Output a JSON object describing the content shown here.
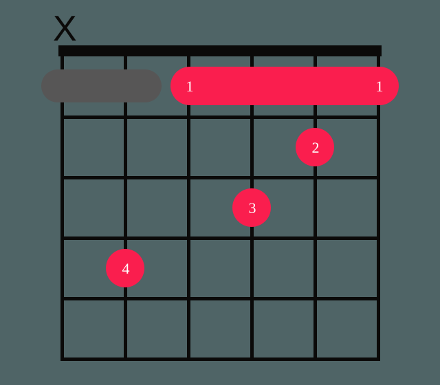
{
  "chart_data": {
    "type": "guitar-chord-diagram",
    "strings": 6,
    "frets_shown": 5,
    "nut_shown": true,
    "colors": {
      "accent": "#fa1e4e",
      "grid": "#0b0a09",
      "muted": "#575656",
      "background": "#4f6466"
    },
    "string_states": [
      "muted",
      null,
      null,
      null,
      null,
      null
    ],
    "mute_symbol": "X",
    "barre": {
      "fret": 1,
      "from_string": 4,
      "to_string": 1,
      "finger": 1
    },
    "muted_barre_segment": {
      "fret": 1,
      "from_string": 6,
      "to_string": 5
    },
    "fingers": [
      {
        "string": 2,
        "fret": 2,
        "finger": 2
      },
      {
        "string": 3,
        "fret": 3,
        "finger": 3
      },
      {
        "string": 5,
        "fret": 4,
        "finger": 4
      }
    ],
    "barre_labels": {
      "left": "1",
      "right": "1"
    },
    "finger_labels": {
      "f2": "2",
      "f3": "3",
      "f4": "4"
    }
  }
}
